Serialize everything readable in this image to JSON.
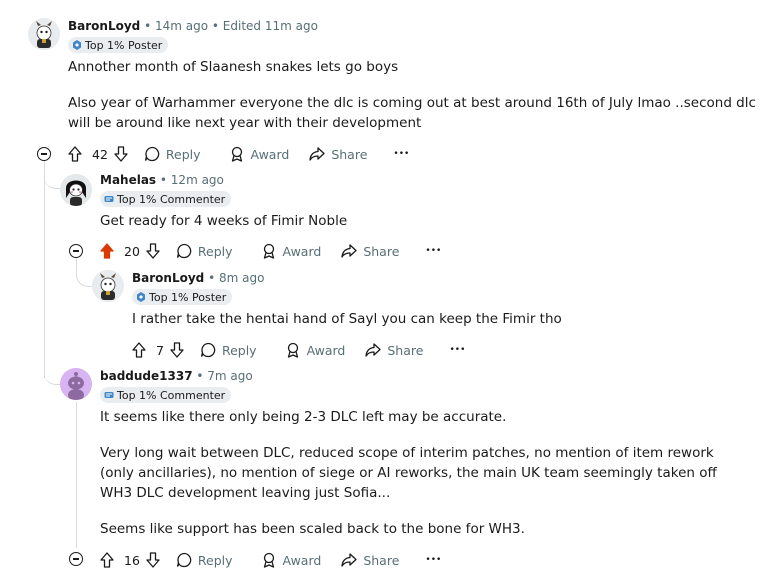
{
  "comments": [
    {
      "author": "BaronLoyd",
      "meta": "• 14m ago • Edited 11m ago",
      "flair": "Top 1% Poster",
      "paragraphs": [
        "Annother month of Slaanesh snakes lets go boys",
        "Also year of Warhammer everyone the dlc is coming out at best around 16th of July lmao ..second dlc will be around like next year with their development"
      ],
      "votes": "42",
      "upvoted": false
    },
    {
      "author": "Mahelas",
      "meta": "• 12m ago",
      "flair": "Top 1% Commenter",
      "paragraphs": [
        "Get ready for 4 weeks of Fimir Noble"
      ],
      "votes": "20",
      "upvoted": true
    },
    {
      "author": "BaronLoyd",
      "meta": "• 8m ago",
      "flair": "Top 1% Poster",
      "paragraphs": [
        "I rather take the hentai hand of Sayl you can keep the Fimir tho"
      ],
      "votes": "7",
      "upvoted": false
    },
    {
      "author": "baddude1337",
      "meta": "• 7m ago",
      "flair": "Top 1% Commenter",
      "paragraphs": [
        "It seems like there only being 2-3 DLC left may be accurate.",
        "Very long wait between DLC, reduced scope of interim patches, no mention of item rework (only ancillaries), no mention of siege or AI reworks, the main UK team seemingly taken off WH3 DLC development leaving just Sofia...",
        "Seems like support has been scaled back to the bone for WH3."
      ],
      "votes": "16",
      "upvoted": false
    }
  ],
  "labels": {
    "reply": "Reply",
    "award": "Award",
    "share": "Share",
    "more": "•••"
  },
  "colors": {
    "upvote_active": "#d93a00",
    "meta": "#576f76",
    "thread": "#d7dadc"
  }
}
